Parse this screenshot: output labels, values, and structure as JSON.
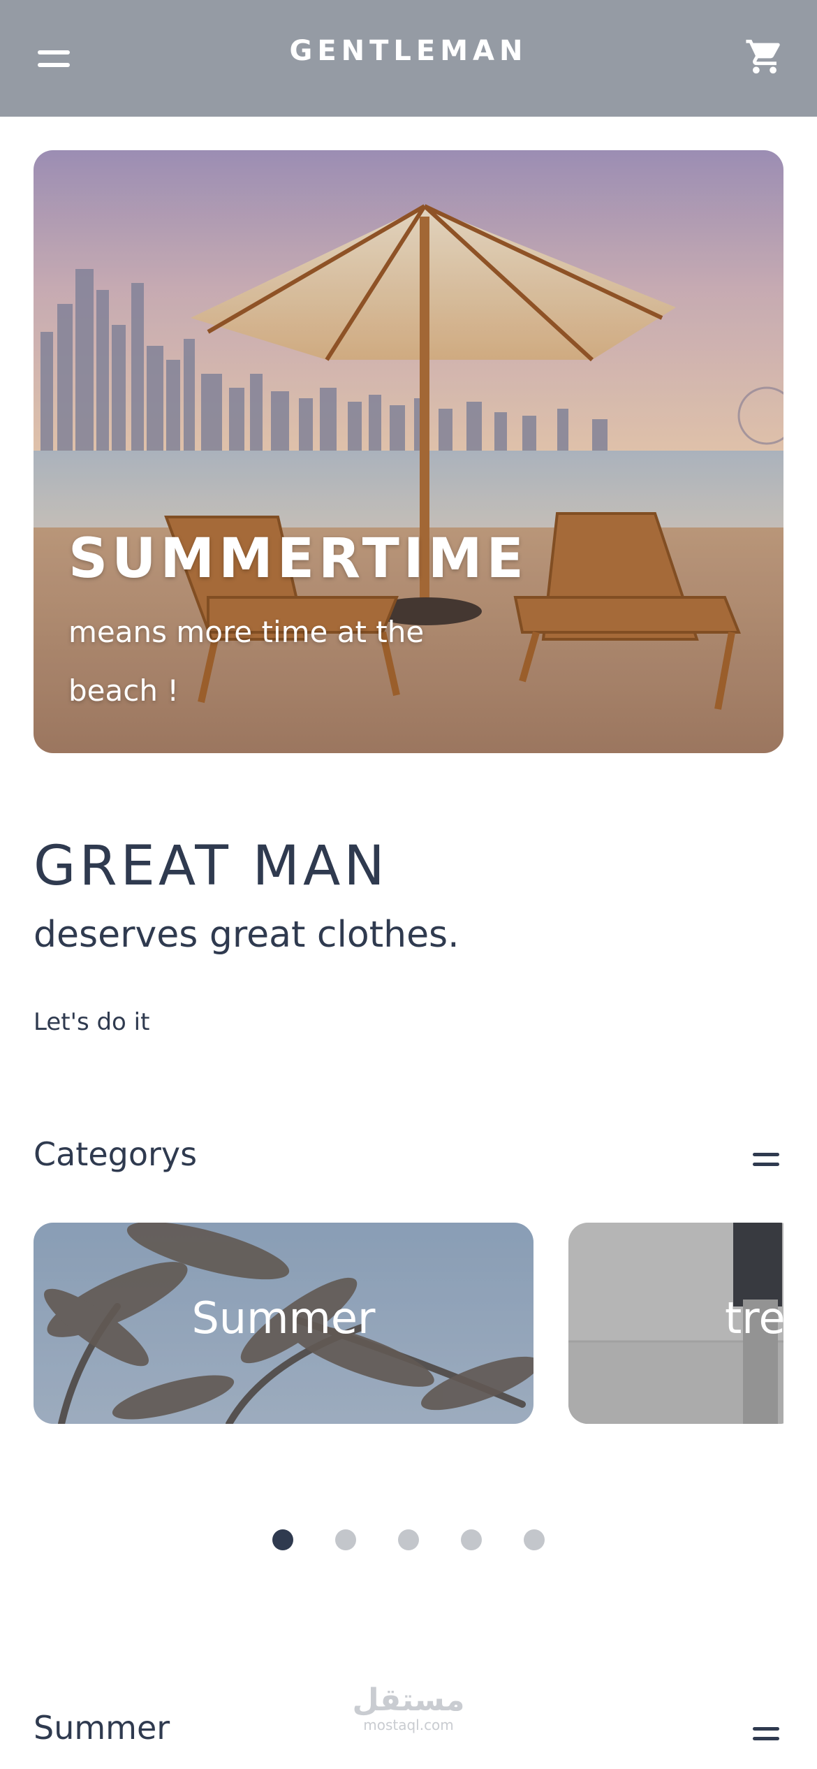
{
  "header": {
    "brand": "GENTLEMAN",
    "menu_icon": "hamburger-menu-icon",
    "cart_icon": "shopping-cart-icon",
    "background": "#959ba4"
  },
  "hero": {
    "title": "SUMMERTIME",
    "subtitle": "means more time at the beach !"
  },
  "intro": {
    "title": "GREAT MAN",
    "tagline": "deserves great clothes.",
    "cta": "Let's do it"
  },
  "categories": {
    "title": "Categorys",
    "menu_icon": "equals-menu-icon",
    "items": [
      {
        "label": "Summer"
      },
      {
        "label": "tre"
      }
    ],
    "pagination": {
      "count": 5,
      "active_index": 0
    }
  },
  "summer_section": {
    "title": "Summer",
    "menu_icon": "equals-menu-icon"
  },
  "watermark": {
    "arabic": "مستقل",
    "latin": "mostaql.com"
  },
  "colors": {
    "text": "#2f3a4f",
    "dot_inactive": "#c3c6cb",
    "dot_active": "#2f3a4f"
  }
}
